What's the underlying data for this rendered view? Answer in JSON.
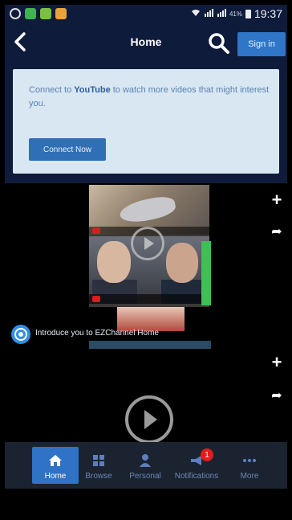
{
  "status_bar": {
    "battery": "41%",
    "time": "19:37"
  },
  "header": {
    "title": "Home",
    "signin_label": "Sign in"
  },
  "banner": {
    "text_prefix": "Connect to ",
    "text_brand": "YouTube",
    "text_suffix": " to watch more videos that might interest you.",
    "button_label": "Connect Now"
  },
  "feed": {
    "intro_text": "Introduce you to EZChannel Home"
  },
  "bottom_nav": {
    "items": [
      {
        "label": "Home",
        "icon": "home-icon",
        "active": true
      },
      {
        "label": "Browse",
        "icon": "grid-icon",
        "active": false
      },
      {
        "label": "Personal",
        "icon": "person-icon",
        "active": false
      },
      {
        "label": "Notifications",
        "icon": "megaphone-icon",
        "active": false,
        "badge": "1"
      },
      {
        "label": "More",
        "icon": "more-icon",
        "active": false
      }
    ]
  },
  "colors": {
    "header_bg": "#0e1b3a",
    "accent_blue": "#2f72c6",
    "banner_bg": "#d9e7f3",
    "badge_red": "#e31c1c"
  }
}
